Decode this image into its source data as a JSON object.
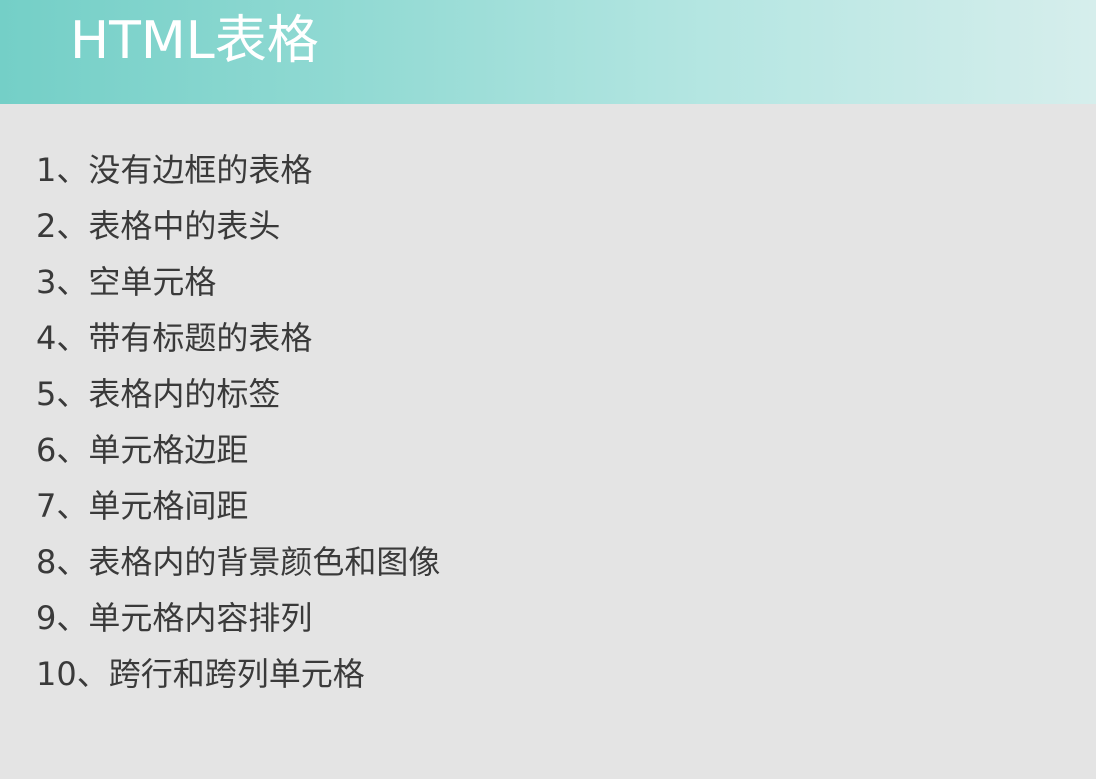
{
  "slide": {
    "title": "HTML表格",
    "items": [
      "1、没有边框的表格",
      "2、表格中的表头",
      "3、空单元格",
      "4、带有标题的表格",
      "5、表格内的标签",
      "6、单元格边距",
      "7、单元格间距",
      "8、表格内的背景颜色和图像",
      "9、单元格内容排列",
      "10、跨行和跨列单元格"
    ]
  },
  "colors": {
    "header_start": "#74cfc7",
    "header_end": "#d6eeec",
    "background": "#e4e4e4",
    "title_text": "#ffffff",
    "body_text": "#3a3a3a"
  }
}
